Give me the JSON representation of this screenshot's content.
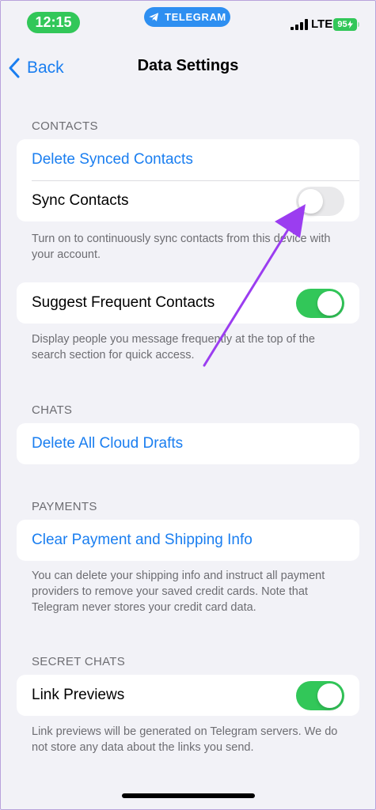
{
  "status_bar": {
    "time": "12:15",
    "app_pill": "TELEGRAM",
    "network": "LTE",
    "battery": "95"
  },
  "nav": {
    "back_label": "Back",
    "title": "Data Settings"
  },
  "sections": {
    "contacts": {
      "header": "CONTACTS",
      "delete_synced": "Delete Synced Contacts",
      "sync_contacts": "Sync Contacts",
      "sync_footnote": "Turn on to continuously sync contacts from this device with your account.",
      "suggest_frequent": "Suggest Frequent Contacts",
      "suggest_footnote": "Display people you message frequently at the top of the search section for quick access."
    },
    "chats": {
      "header": "CHATS",
      "delete_drafts": "Delete All Cloud Drafts"
    },
    "payments": {
      "header": "PAYMENTS",
      "clear_payment": "Clear Payment and Shipping Info",
      "footnote": "You can delete your shipping info and instruct all payment providers to remove your saved credit cards. Note that Telegram never stores your credit card data."
    },
    "secret_chats": {
      "header": "SECRET CHATS",
      "link_previews": "Link Previews",
      "footnote": "Link previews will be generated on Telegram servers. We do not store any data about the links you send."
    }
  },
  "colors": {
    "accent": "#1a7ef0",
    "toggle_on": "#32c759",
    "annotation_arrow": "#9b3df0"
  },
  "toggles": {
    "sync_contacts": false,
    "suggest_frequent": true,
    "link_previews": true
  }
}
